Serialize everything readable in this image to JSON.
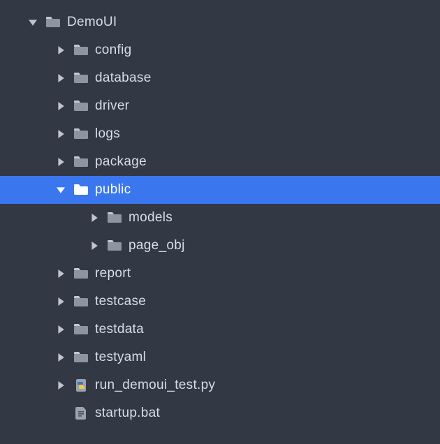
{
  "tree": [
    {
      "id": "root",
      "label": "DemoUI",
      "level": 0,
      "expanded": true,
      "selected": false,
      "icon": "folder"
    },
    {
      "id": "config",
      "label": "config",
      "level": 1,
      "expanded": false,
      "selected": false,
      "icon": "folder"
    },
    {
      "id": "database",
      "label": "database",
      "level": 1,
      "expanded": false,
      "selected": false,
      "icon": "folder"
    },
    {
      "id": "driver",
      "label": "driver",
      "level": 1,
      "expanded": false,
      "selected": false,
      "icon": "folder"
    },
    {
      "id": "logs",
      "label": "logs",
      "level": 1,
      "expanded": false,
      "selected": false,
      "icon": "folder"
    },
    {
      "id": "package",
      "label": "package",
      "level": 1,
      "expanded": false,
      "selected": false,
      "icon": "folder"
    },
    {
      "id": "public",
      "label": "public",
      "level": 1,
      "expanded": true,
      "selected": true,
      "icon": "folder"
    },
    {
      "id": "models",
      "label": "models",
      "level": 2,
      "expanded": false,
      "selected": false,
      "icon": "folder"
    },
    {
      "id": "pageobj",
      "label": "page_obj",
      "level": 2,
      "expanded": false,
      "selected": false,
      "icon": "folder"
    },
    {
      "id": "report",
      "label": "report",
      "level": 1,
      "expanded": false,
      "selected": false,
      "icon": "folder"
    },
    {
      "id": "testcase",
      "label": "testcase",
      "level": 1,
      "expanded": false,
      "selected": false,
      "icon": "folder"
    },
    {
      "id": "testdata",
      "label": "testdata",
      "level": 1,
      "expanded": false,
      "selected": false,
      "icon": "folder"
    },
    {
      "id": "testyaml",
      "label": "testyaml",
      "level": 1,
      "expanded": false,
      "selected": false,
      "icon": "folder"
    },
    {
      "id": "runpy",
      "label": "run_demoui_test.py",
      "level": 1,
      "expanded": false,
      "selected": false,
      "icon": "pyfile"
    },
    {
      "id": "startup",
      "label": "startup.bat",
      "level": 1,
      "expanded": null,
      "selected": false,
      "icon": "batfile"
    }
  ],
  "colors": {
    "background": "#323844",
    "selected": "#3a77ef",
    "text": "#d8dee8",
    "arrow": "#c0c5cf",
    "folderFill": "#8d95a3",
    "folderTab": "#c3c9d4",
    "pyBlue": "#3a77b7",
    "pyYellow": "#f2c94c",
    "fileFill": "#9aa3b1"
  }
}
